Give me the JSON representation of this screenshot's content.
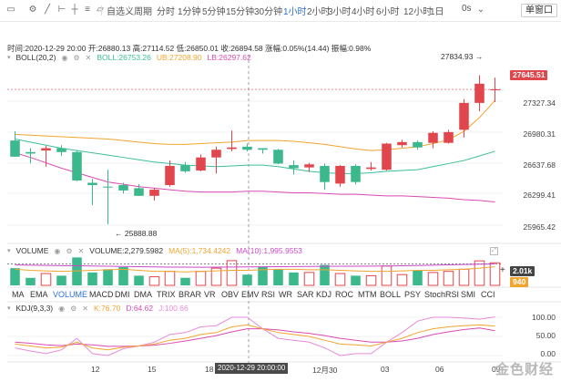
{
  "toolbar": {
    "timeframes": [
      "自选义周期",
      "分时",
      "1分钟",
      "5分钟",
      "15分钟",
      "30分钟",
      "1小时",
      "2小时",
      "3小时",
      "4小时",
      "6小时",
      "12小时",
      "1日"
    ],
    "active_timeframe": "1小时",
    "countdown": "0s",
    "single_window": "单窗口",
    "icons": [
      "candle-icon",
      "settings-icon",
      "draw-line-icon",
      "measure-icon",
      "crosshair-icon",
      "fib-icon",
      "text-icon",
      "shape-icon",
      "redo-icon"
    ]
  },
  "info": {
    "time": "时间:2020-12-29 20:00",
    "open": "开:26880.13",
    "high": "高:27114.52",
    "low": "低:26850.01",
    "close": "收:26894.58",
    "change": "涨幅:0.05%(14.44)",
    "amplitude": "振幅:0.98%"
  },
  "boll": {
    "name": "BOLL(20,2)",
    "boll": "BOLL:26753.26",
    "ub": "UB:27208.90",
    "lb": "LB:26297.62"
  },
  "volume": {
    "name": "VOLUME",
    "vol": "VOLUME:2,279.5982",
    "ma5": "MA(5):1,734.4242",
    "ma10": "MA(10):1,995.9553",
    "tag_high": "2.01k",
    "tag_low": "940"
  },
  "kdj": {
    "name": "KDJ(9,3,3)",
    "k": "K:76.70",
    "d": "D:64.62",
    "j": "J:100.66",
    "yticks": [
      "100.00",
      "50.00",
      "0.00"
    ]
  },
  "tabs": [
    "MA",
    "EMA",
    "VOLUME",
    "MACD",
    "DMI",
    "DMA",
    "TRIX",
    "BRAR",
    "VR",
    "OBV",
    "EMV",
    "RSI",
    "WR",
    "SAR",
    "KDJ",
    "ROC",
    "MTM",
    "BOLL",
    "PSY",
    "StochRSI",
    "SMI",
    "CCI"
  ],
  "active_tab": "VOLUME",
  "price_axis": [
    "27327.34",
    "26980.31",
    "26637.68",
    "26299.41",
    "25965.42"
  ],
  "max_label": "27834.93",
  "min_label": "25888.88",
  "current_price": "27645.51",
  "x_ticks": [
    "12",
    "15",
    "18",
    "12月30",
    "03",
    "06",
    "09"
  ],
  "cross_time": "2020-12-29 20:00:00",
  "watermark": "金色财经",
  "colors": {
    "up": "#e0464b",
    "down": "#3bb88c",
    "boll": "#f0a530",
    "lb": "#d94bb5",
    "ub": "#f0a530",
    "mid": "#3bbf9a",
    "ma5": "#f0a530",
    "ma10": "#c94bc7",
    "k": "#f0a530",
    "d": "#d94bb5",
    "j": "#e88ad8"
  },
  "chart_data": {
    "type": "candlestick",
    "ylim": [
      25700,
      28050
    ],
    "candles": [
      {
        "o": 26980,
        "h": 27100,
        "l": 26770,
        "c": 26770
      },
      {
        "o": 26830,
        "h": 26880,
        "l": 26680,
        "c": 26810
      },
      {
        "o": 26850,
        "h": 26910,
        "l": 26640,
        "c": 26880
      },
      {
        "o": 26880,
        "h": 26920,
        "l": 26780,
        "c": 26830
      },
      {
        "o": 26830,
        "h": 26850,
        "l": 26450,
        "c": 26460
      },
      {
        "o": 26430,
        "h": 26480,
        "l": 26140,
        "c": 26400
      },
      {
        "o": 26380,
        "h": 26600,
        "l": 25890,
        "c": 26370
      },
      {
        "o": 26400,
        "h": 26430,
        "l": 26290,
        "c": 26330
      },
      {
        "o": 26360,
        "h": 26410,
        "l": 26260,
        "c": 26260
      },
      {
        "o": 26260,
        "h": 26360,
        "l": 26200,
        "c": 26340
      },
      {
        "o": 26400,
        "h": 26720,
        "l": 26380,
        "c": 26650
      },
      {
        "o": 26660,
        "h": 26700,
        "l": 26560,
        "c": 26580
      },
      {
        "o": 26590,
        "h": 26800,
        "l": 26580,
        "c": 26760
      },
      {
        "o": 26760,
        "h": 26900,
        "l": 26550,
        "c": 26860
      },
      {
        "o": 26870,
        "h": 27110,
        "l": 26840,
        "c": 26890
      },
      {
        "o": 26900,
        "h": 26940,
        "l": 26840,
        "c": 26860
      },
      {
        "o": 26880,
        "h": 26880,
        "l": 26810,
        "c": 26860
      },
      {
        "o": 26860,
        "h": 26870,
        "l": 26670,
        "c": 26680
      },
      {
        "o": 26660,
        "h": 26720,
        "l": 26540,
        "c": 26620
      },
      {
        "o": 26630,
        "h": 26690,
        "l": 26570,
        "c": 26670
      },
      {
        "o": 26650,
        "h": 26680,
        "l": 26340,
        "c": 26440
      },
      {
        "o": 26420,
        "h": 26660,
        "l": 26380,
        "c": 26650
      },
      {
        "o": 26650,
        "h": 26670,
        "l": 26410,
        "c": 26440
      },
      {
        "o": 26610,
        "h": 26700,
        "l": 26590,
        "c": 26630
      },
      {
        "o": 26600,
        "h": 26950,
        "l": 26590,
        "c": 26940
      },
      {
        "o": 26920,
        "h": 26990,
        "l": 26890,
        "c": 26960
      },
      {
        "o": 26960,
        "h": 26980,
        "l": 26860,
        "c": 26890
      },
      {
        "o": 26950,
        "h": 27100,
        "l": 26880,
        "c": 27080
      },
      {
        "o": 26950,
        "h": 27120,
        "l": 26940,
        "c": 27090
      },
      {
        "o": 27120,
        "h": 27520,
        "l": 27020,
        "c": 27470
      },
      {
        "o": 27470,
        "h": 27830,
        "l": 27360,
        "c": 27720
      },
      {
        "o": 27640,
        "h": 27800,
        "l": 27480,
        "c": 27646
      }
    ],
    "mid": [
      27000,
      26960,
      26920,
      26880,
      26850,
      26820,
      26790,
      26760,
      26730,
      26700,
      26680,
      26660,
      26650,
      26640,
      26650,
      26660,
      26660,
      26640,
      26610,
      26580,
      26560,
      26550,
      26550,
      26560,
      26580,
      26590,
      26600,
      26640,
      26680,
      26720,
      26780,
      26840
    ],
    "upper": [
      27060,
      27050,
      27040,
      27030,
      27020,
      27010,
      27000,
      26980,
      26960,
      26940,
      26930,
      26930,
      26940,
      26950,
      26960,
      26980,
      26980,
      26980,
      26970,
      26950,
      26930,
      26900,
      26870,
      26850,
      26860,
      26880,
      26900,
      26940,
      26990,
      27100,
      27280,
      27500
    ],
    "lower": [
      26820,
      26760,
      26690,
      26620,
      26560,
      26500,
      26440,
      26410,
      26380,
      26360,
      26340,
      26320,
      26310,
      26310,
      26310,
      26320,
      26320,
      26310,
      26300,
      26300,
      26290,
      26280,
      26280,
      26270,
      26260,
      26260,
      26250,
      26240,
      26230,
      26210,
      26200,
      26180
    ],
    "volume": [
      1600,
      700,
      1100,
      900,
      2600,
      1200,
      1500,
      1700,
      900,
      800,
      1300,
      700,
      1300,
      1600,
      2300,
      1000,
      1700,
      1500,
      1200,
      1200,
      1900,
      1100,
      900,
      900,
      1800,
      1000,
      1400,
      1200,
      1300,
      1500,
      2280,
      2100
    ],
    "vol_ma5": [
      1500,
      1400,
      1350,
      1300,
      1350,
      1400,
      1450,
      1500,
      1400,
      1300,
      1300,
      1250,
      1300,
      1350,
      1400,
      1400,
      1450,
      1500,
      1500,
      1450,
      1450,
      1400,
      1350,
      1300,
      1300,
      1350,
      1400,
      1400,
      1450,
      1500,
      1600,
      1734
    ],
    "vol_ma10": [
      1900,
      1880,
      1860,
      1840,
      1820,
      1800,
      1780,
      1760,
      1740,
      1720,
      1700,
      1700,
      1690,
      1700,
      1710,
      1720,
      1730,
      1740,
      1750,
      1760,
      1770,
      1780,
      1780,
      1790,
      1800,
      1820,
      1850,
      1880,
      1910,
      1940,
      1970,
      1996
    ],
    "k": [
      30,
      25,
      20,
      22,
      35,
      20,
      15,
      22,
      25,
      30,
      40,
      45,
      55,
      60,
      75,
      80,
      70,
      60,
      55,
      50,
      40,
      30,
      28,
      25,
      35,
      45,
      60,
      70,
      75,
      78,
      80,
      77
    ],
    "d": [
      35,
      32,
      28,
      26,
      30,
      28,
      24,
      24,
      25,
      27,
      32,
      38,
      45,
      52,
      62,
      70,
      70,
      67,
      62,
      58,
      52,
      45,
      40,
      35,
      35,
      38,
      45,
      55,
      62,
      68,
      72,
      65
    ],
    "j": [
      20,
      12,
      5,
      15,
      45,
      5,
      0,
      18,
      25,
      35,
      55,
      60,
      75,
      78,
      100,
      100,
      70,
      45,
      40,
      35,
      20,
      0,
      5,
      5,
      35,
      60,
      90,
      100,
      100,
      98,
      95,
      101
    ]
  }
}
